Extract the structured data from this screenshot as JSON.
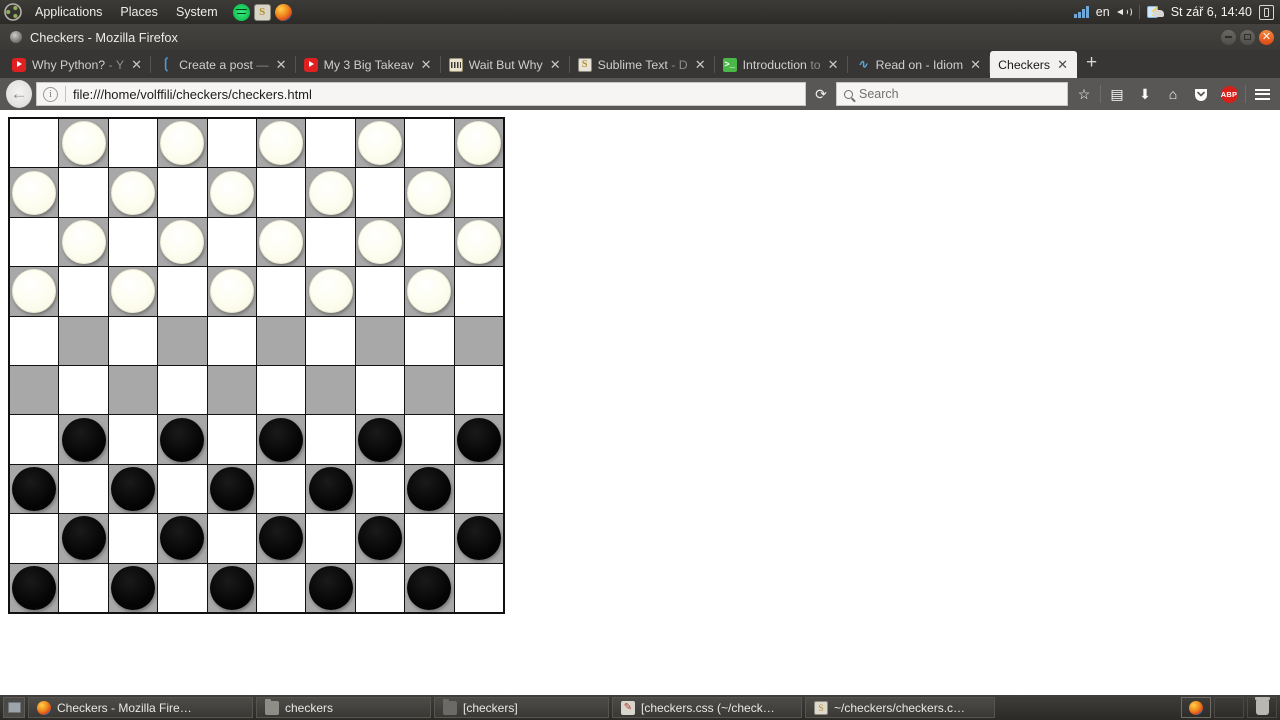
{
  "desktop": {
    "top_panel": {
      "logo_icon": "ubuntu-logo-icon",
      "menus": [
        "Applications",
        "Places",
        "System"
      ],
      "tray_apps": [
        {
          "icon": "spotify-icon",
          "name": "Spotify"
        },
        {
          "icon": "sublime-text-icon",
          "name": "Sublime Text",
          "glyph": "S"
        },
        {
          "icon": "firefox-icon",
          "name": "Firefox"
        }
      ],
      "indicators": {
        "network_icon": "signal-bars-icon",
        "keyboard_layout": "en",
        "volume_icon": "volume-icon",
        "battery_icon": "battery-charging-icon",
        "clock": "St zář 6, 14:40",
        "session_icon": "session-menu-icon"
      }
    },
    "taskbar": {
      "show_desktop_icon": "show-desktop-icon",
      "items": [
        {
          "icon": "firefox-icon",
          "label": "Checkers - Mozilla Fire…"
        },
        {
          "icon": "folder-icon",
          "label": "checkers"
        },
        {
          "icon": "folder-icon",
          "label": "[checkers]"
        },
        {
          "icon": "text-editor-icon",
          "label": "[checkers.css (~/check…"
        },
        {
          "icon": "sublime-text-icon",
          "label": "~/checkers/checkers.c…"
        }
      ],
      "tray": [
        {
          "icon": "firefox-icon"
        },
        {
          "icon": "empty-slot-icon"
        },
        {
          "icon": "trash-icon"
        }
      ]
    }
  },
  "window": {
    "title": "Checkers - Mozilla Firefox",
    "controls": {
      "minimize": "minimize-button",
      "maximize": "maximize-button",
      "close": "close-button"
    }
  },
  "browser": {
    "tabs": [
      {
        "favicon": "youtube-icon",
        "label": "Why Python?",
        "label_dim": " - Y",
        "active": false
      },
      {
        "favicon": "medium-icon",
        "label": "Create a post",
        "label_dim": " —",
        "active": false
      },
      {
        "favicon": "youtube-icon",
        "label": "My 3 Big Takeav",
        "label_dim": "",
        "active": false
      },
      {
        "favicon": "waitbutwhy-icon",
        "label": "Wait But Why",
        "label_dim": "",
        "active": false
      },
      {
        "favicon": "sublime-icon",
        "label": "Sublime Text",
        "label_dim": " - D",
        "active": false
      },
      {
        "favicon": "terminal-icon",
        "label": "Introduction",
        "label_dim": " to",
        "active": false
      },
      {
        "favicon": "idiom-icon",
        "label": "Read on - Idiom",
        "label_dim": "",
        "active": false
      },
      {
        "favicon": "none",
        "label": "Checkers",
        "label_dim": "",
        "active": true
      }
    ],
    "tab_close_label": "✕",
    "new_tab_label": "+",
    "navigation": {
      "back_label": "←",
      "identity_icon": "page-info-icon",
      "url": "file:///home/volffili/checkers/checkers.html",
      "reload_label": "⟳"
    },
    "search": {
      "icon": "search-icon",
      "placeholder": "Search",
      "value": ""
    },
    "toolbar_icons": [
      {
        "name": "bookmark-star-icon",
        "glyph": "☆"
      },
      {
        "name": "reading-list-icon",
        "glyph": "▤"
      },
      {
        "name": "downloads-icon",
        "glyph": "⬇"
      },
      {
        "name": "home-icon",
        "glyph": "⌂"
      },
      {
        "name": "pocket-icon",
        "glyph": "⌄"
      },
      {
        "name": "adblock-plus-icon",
        "glyph": "ABP"
      },
      {
        "name": "menu-hamburger-icon",
        "glyph": "≡"
      }
    ]
  },
  "page": {
    "board": {
      "size": 10,
      "colors": {
        "light_square": "#ffffff",
        "dark_square": "#a8a8a8",
        "border": "#111111",
        "white_piece": "#fdfdef",
        "black_piece": "#000000"
      },
      "legend": {
        "0": "empty",
        "w": "white-piece",
        "b": "black-piece"
      },
      "rows": [
        [
          "",
          "w",
          "",
          "w",
          "",
          "w",
          "",
          "w",
          "",
          "w"
        ],
        [
          "w",
          "",
          "w",
          "",
          "w",
          "",
          "w",
          "",
          "w",
          ""
        ],
        [
          "",
          "w",
          "",
          "w",
          "",
          "w",
          "",
          "w",
          "",
          "w"
        ],
        [
          "w",
          "",
          "w",
          "",
          "w",
          "",
          "w",
          "",
          "w",
          ""
        ],
        [
          "",
          "",
          "",
          "",
          "",
          "",
          "",
          "",
          "",
          ""
        ],
        [
          "",
          "",
          "",
          "",
          "",
          "",
          "",
          "",
          "",
          ""
        ],
        [
          "",
          "b",
          "",
          "b",
          "",
          "b",
          "",
          "b",
          "",
          "b"
        ],
        [
          "b",
          "",
          "b",
          "",
          "b",
          "",
          "b",
          "",
          "b",
          ""
        ],
        [
          "",
          "b",
          "",
          "b",
          "",
          "b",
          "",
          "b",
          "",
          "b"
        ],
        [
          "b",
          "",
          "b",
          "",
          "b",
          "",
          "b",
          "",
          "b",
          ""
        ]
      ]
    }
  }
}
